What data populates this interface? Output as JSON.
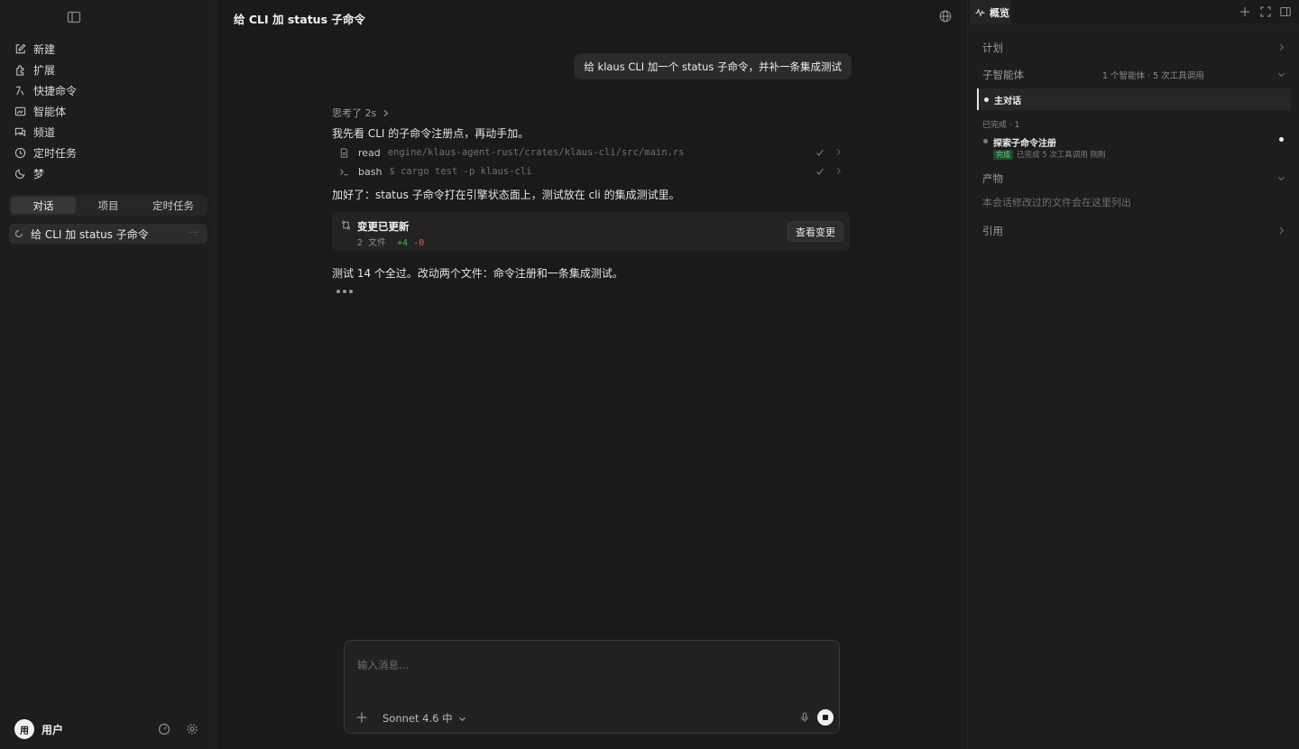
{
  "sidebar": {
    "nav": [
      {
        "label": "新建",
        "icon": "new-chat-icon"
      },
      {
        "label": "扩展",
        "icon": "extensions-icon"
      },
      {
        "label": "快捷命令",
        "icon": "shortcut-icon"
      },
      {
        "label": "智能体",
        "icon": "agent-icon"
      },
      {
        "label": "频道",
        "icon": "channel-icon"
      },
      {
        "label": "定时任务",
        "icon": "clock-icon"
      },
      {
        "label": "梦",
        "icon": "moon-icon"
      }
    ],
    "tabs": [
      "对话",
      "项目",
      "定时任务"
    ],
    "active_tab": "对话",
    "conversation": {
      "title": "给 CLI 加 status 子命令",
      "more": "···"
    },
    "user": {
      "avatar": "用",
      "name": "用户"
    }
  },
  "main": {
    "title": "给 CLI 加 status 子命令",
    "user_message": "给 klaus CLI 加一个 status 子命令，并补一条集成测试",
    "thinking": "思考了 2s",
    "para1": "我先看 CLI 的子命令注册点，再动手加。",
    "tools": [
      {
        "name": "read",
        "arg": "engine/klaus-agent-rust/crates/klaus-cli/src/main.rs",
        "icon": "file-icon"
      },
      {
        "name": "bash",
        "arg": "$ cargo test -p klaus-cli",
        "icon": "terminal-icon"
      }
    ],
    "para2": "加好了：status 子命令打在引擎状态面上，测试放在 cli 的集成测试里。",
    "change": {
      "title": "变更已更新",
      "files": "2 文件",
      "added": "+4",
      "removed": "-0",
      "button": "查看变更"
    },
    "para3": "测试 14 个全过。改动两个文件：命令注册和一条集成测试。",
    "composer": {
      "placeholder": "输入消息...",
      "model": "Sonnet 4.6",
      "effort": "中"
    }
  },
  "right_panel": {
    "tab": "概览",
    "sections": {
      "plan": "计划",
      "subagents": "子智能体",
      "subagents_meta": "1 个智能体 · 5 次工具调用",
      "artifacts": "产物",
      "artifacts_empty": "本会话修改过的文件会在这里列出",
      "references": "引用"
    },
    "main_conversation": "主对话",
    "done_label": "已完成 · 1",
    "sub_agent": {
      "name": "探索子命令注册",
      "badge": "完成",
      "meta": "已完成 5 次工具调用 刚刚"
    }
  }
}
